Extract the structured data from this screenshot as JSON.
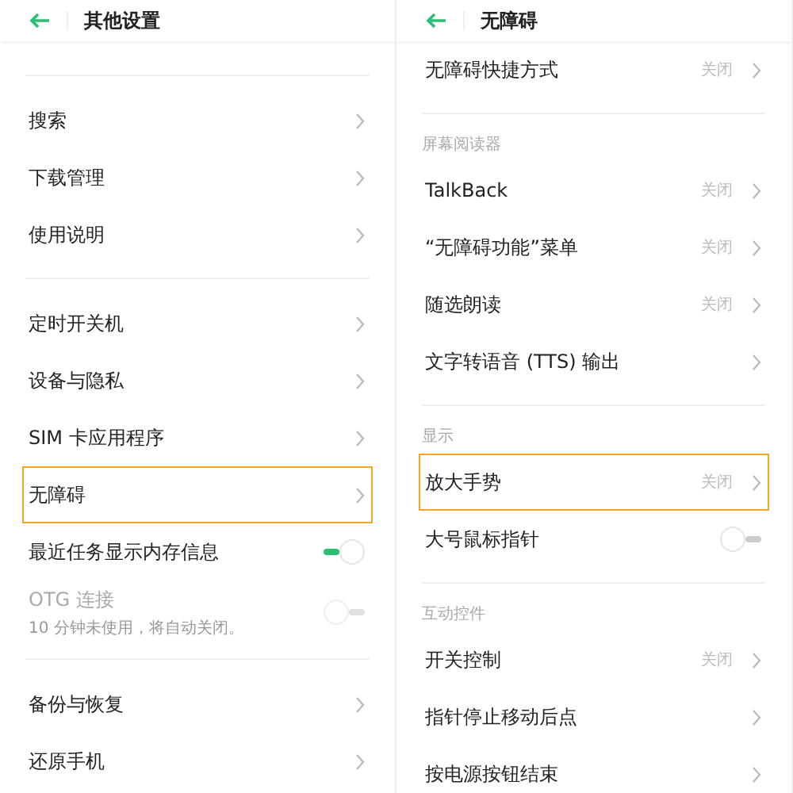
{
  "panels": [
    {
      "title": "其他设置",
      "items": [
        {
          "kind": "divider"
        },
        {
          "kind": "link",
          "label": "搜索",
          "highlighted": false
        },
        {
          "kind": "link",
          "label": "下载管理",
          "highlighted": false
        },
        {
          "kind": "link",
          "label": "使用说明",
          "highlighted": false
        },
        {
          "kind": "divider"
        },
        {
          "kind": "link",
          "label": "定时开关机",
          "highlighted": false
        },
        {
          "kind": "link",
          "label": "设备与隐私",
          "highlighted": false
        },
        {
          "kind": "link",
          "label": "SIM 卡应用程序",
          "highlighted": false
        },
        {
          "kind": "link",
          "label": "无障碍",
          "highlighted": true
        },
        {
          "kind": "toggle",
          "label": "最近任务显示内存信息",
          "on": true,
          "disabled": false
        },
        {
          "kind": "toggle",
          "label": "OTG 连接",
          "subtitle": "10 分钟未使用，将自动关闭。",
          "on": false,
          "disabled": true
        },
        {
          "kind": "divider"
        },
        {
          "kind": "link",
          "label": "备份与恢复",
          "highlighted": false
        },
        {
          "kind": "link",
          "label": "还原手机",
          "highlighted": false
        }
      ]
    },
    {
      "title": "无障碍",
      "items": [
        {
          "kind": "link",
          "label": "无障碍快捷方式",
          "value": "关闭",
          "highlighted": false
        },
        {
          "kind": "divider"
        },
        {
          "kind": "section",
          "label": "屏幕阅读器"
        },
        {
          "kind": "link",
          "label": "TalkBack",
          "value": "关闭",
          "highlighted": false
        },
        {
          "kind": "link",
          "label": "“无障碍功能”菜单",
          "value": "关闭",
          "highlighted": false
        },
        {
          "kind": "link",
          "label": "随选朗读",
          "value": "关闭",
          "highlighted": false
        },
        {
          "kind": "link",
          "label": "文字转语音 (TTS) 输出",
          "highlighted": false
        },
        {
          "kind": "divider"
        },
        {
          "kind": "section",
          "label": "显示"
        },
        {
          "kind": "link",
          "label": "放大手势",
          "value": "关闭",
          "highlighted": true
        },
        {
          "kind": "toggle",
          "label": "大号鼠标指针",
          "on": false,
          "disabled": false
        },
        {
          "kind": "divider"
        },
        {
          "kind": "section",
          "label": "互动控件"
        },
        {
          "kind": "link",
          "label": "开关控制",
          "value": "关闭",
          "highlighted": false
        },
        {
          "kind": "link",
          "label": "指针停止移动后点",
          "highlighted": false
        },
        {
          "kind": "link",
          "label": "按电源按钮结束",
          "highlighted": false
        }
      ]
    }
  ]
}
